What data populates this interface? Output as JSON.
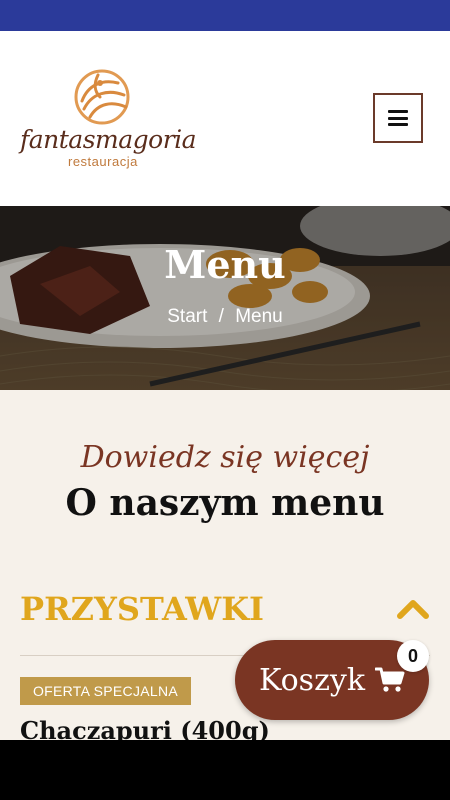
{
  "brand": {
    "name": "fantasmagoria",
    "subtitle": "restauracja"
  },
  "header": {
    "menu_icon": "hamburger-icon"
  },
  "hero": {
    "title": "Menu",
    "breadcrumb": {
      "home": "Start",
      "separator": "/",
      "current": "Menu"
    }
  },
  "intro": {
    "kicker": "Dowiedz się więcej",
    "title": "O naszym menu"
  },
  "category": {
    "title": "PRZYSTAWKI",
    "toggle_icon": "chevron-up-icon",
    "expanded": true
  },
  "item": {
    "badge": "OFERTA SPECJALNA",
    "name": "Chaczapuri (400g)"
  },
  "cart": {
    "label": "Koszyk",
    "icon": "cart-icon",
    "count": "0"
  },
  "colors": {
    "status_bar": "#2b3a9a",
    "accent_brown": "#7a3523",
    "accent_gold": "#e0a61d",
    "badge": "#c09a4a",
    "content_bg": "#f6f1ea"
  }
}
